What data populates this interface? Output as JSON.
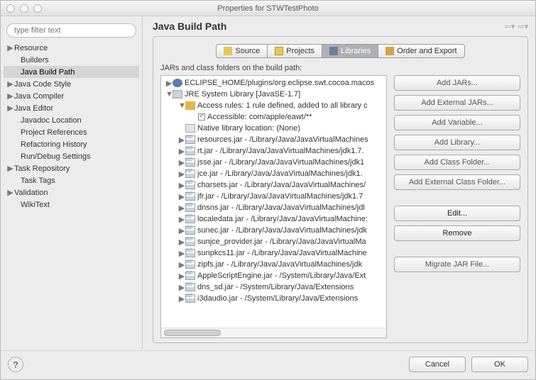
{
  "window_title": "Properties for STWTestPhoto",
  "filter_placeholder": "type filter text",
  "sidebar": {
    "items": [
      {
        "label": "Resource",
        "exp": true,
        "child": false,
        "sel": false
      },
      {
        "label": "Builders",
        "exp": false,
        "child": true,
        "sel": false
      },
      {
        "label": "Java Build Path",
        "exp": false,
        "child": true,
        "sel": true
      },
      {
        "label": "Java Code Style",
        "exp": true,
        "child": false,
        "sel": false
      },
      {
        "label": "Java Compiler",
        "exp": true,
        "child": false,
        "sel": false
      },
      {
        "label": "Java Editor",
        "exp": true,
        "child": false,
        "sel": false
      },
      {
        "label": "Javadoc Location",
        "exp": false,
        "child": true,
        "sel": false
      },
      {
        "label": "Project References",
        "exp": false,
        "child": true,
        "sel": false
      },
      {
        "label": "Refactoring History",
        "exp": false,
        "child": true,
        "sel": false
      },
      {
        "label": "Run/Debug Settings",
        "exp": false,
        "child": true,
        "sel": false
      },
      {
        "label": "Task Repository",
        "exp": true,
        "child": false,
        "sel": false
      },
      {
        "label": "Task Tags",
        "exp": false,
        "child": true,
        "sel": false
      },
      {
        "label": "Validation",
        "exp": true,
        "child": false,
        "sel": false
      },
      {
        "label": "WikiText",
        "exp": false,
        "child": true,
        "sel": false
      }
    ]
  },
  "page_title": "Java Build Path",
  "tabs": [
    {
      "label": "Source",
      "active": false,
      "icon": "ic-source"
    },
    {
      "label": "Projects",
      "active": false,
      "icon": "ic-proj"
    },
    {
      "label": "Libraries",
      "active": true,
      "icon": "ic-lib"
    },
    {
      "label": "Order and Export",
      "active": false,
      "icon": "ic-ord"
    }
  ],
  "subheading": "JARs and class folders on the build path:",
  "tree": [
    {
      "d": 0,
      "tri": "▶",
      "icon": "ic-home",
      "label": "ECLIPSE_HOME/plugins/org.eclipse.swt.cocoa.macos"
    },
    {
      "d": 0,
      "tri": "▼",
      "icon": "ic-jre",
      "label": "JRE System Library [JavaSE-1.7]"
    },
    {
      "d": 1,
      "tri": "▼",
      "icon": "ic-rule",
      "label": "Access rules: 1 rule defined, added to all library c"
    },
    {
      "d": 2,
      "tri": "",
      "icon": "ic-check",
      "label": "Accessible: com/apple/eawt/**"
    },
    {
      "d": 1,
      "tri": "",
      "icon": "ic-native",
      "label": "Native library location: (None)"
    },
    {
      "d": 1,
      "tri": "▶",
      "icon": "ic-jar",
      "label": "resources.jar - /Library/Java/JavaVirtualMachines"
    },
    {
      "d": 1,
      "tri": "▶",
      "icon": "ic-jar",
      "label": "rt.jar - /Library/Java/JavaVirtualMachines/jdk1.7."
    },
    {
      "d": 1,
      "tri": "▶",
      "icon": "ic-jar",
      "label": "jsse.jar - /Library/Java/JavaVirtualMachines/jdk1"
    },
    {
      "d": 1,
      "tri": "▶",
      "icon": "ic-jar",
      "label": "jce.jar - /Library/Java/JavaVirtualMachines/jdk1."
    },
    {
      "d": 1,
      "tri": "▶",
      "icon": "ic-jar",
      "label": "charsets.jar - /Library/Java/JavaVirtualMachines/"
    },
    {
      "d": 1,
      "tri": "▶",
      "icon": "ic-jar",
      "label": "jfr.jar - /Library/Java/JavaVirtualMachines/jdk1.7"
    },
    {
      "d": 1,
      "tri": "▶",
      "icon": "ic-jar",
      "label": "dnsns.jar - /Library/Java/JavaVirtualMachines/jdl"
    },
    {
      "d": 1,
      "tri": "▶",
      "icon": "ic-jar",
      "label": "localedata.jar - /Library/Java/JavaVirtualMachine:"
    },
    {
      "d": 1,
      "tri": "▶",
      "icon": "ic-jar",
      "label": "sunec.jar - /Library/Java/JavaVirtualMachines/jdk"
    },
    {
      "d": 1,
      "tri": "▶",
      "icon": "ic-jar",
      "label": "sunjce_provider.jar - /Library/Java/JavaVirtualMa"
    },
    {
      "d": 1,
      "tri": "▶",
      "icon": "ic-jar",
      "label": "sunpkcs11.jar - /Library/Java/JavaVirtualMachine"
    },
    {
      "d": 1,
      "tri": "▶",
      "icon": "ic-jar",
      "label": "zipfs.jar - /Library/Java/JavaVirtualMachines/jdk"
    },
    {
      "d": 1,
      "tri": "▶",
      "icon": "ic-jar",
      "label": "AppleScriptEngine.jar - /System/Library/Java/Ext"
    },
    {
      "d": 1,
      "tri": "▶",
      "icon": "ic-jar",
      "label": "dns_sd.jar - /System/Library/Java/Extensions"
    },
    {
      "d": 1,
      "tri": "▶",
      "icon": "ic-jar",
      "label": "i3daudio.jar - /System/Library/Java/Extensions"
    }
  ],
  "buttons": {
    "add_jars": "Add JARs...",
    "add_ext_jars": "Add External JARs...",
    "add_var": "Add Variable...",
    "add_lib": "Add Library...",
    "add_cf": "Add Class Folder...",
    "add_ext_cf": "Add External Class Folder...",
    "edit": "Edit...",
    "remove": "Remove",
    "migrate": "Migrate JAR File..."
  },
  "footer": {
    "cancel": "Cancel",
    "ok": "OK"
  }
}
